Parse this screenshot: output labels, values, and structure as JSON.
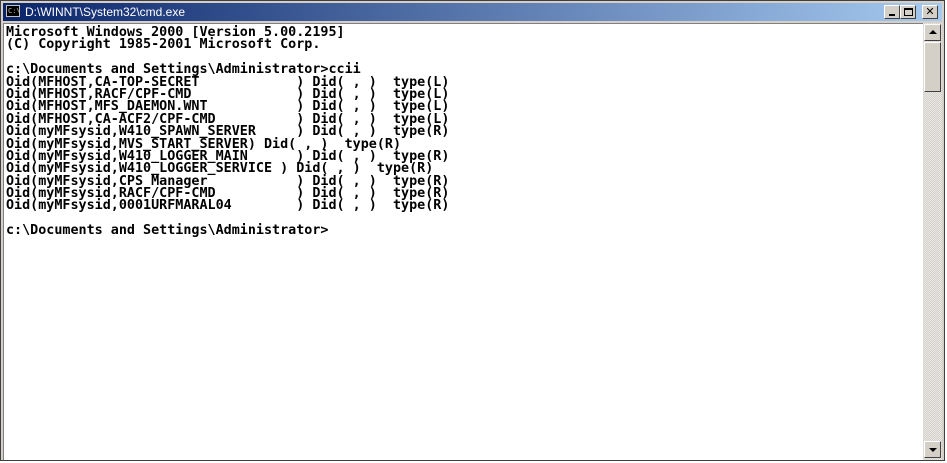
{
  "window": {
    "title": "D:\\WINNT\\System32\\cmd.exe",
    "icon": "cmd-icon",
    "controls": [
      "minimize-icon",
      "maximize-icon",
      "close-icon"
    ]
  },
  "console": {
    "lines": [
      "Microsoft Windows 2000 [Version 5.00.2195]",
      "(C) Copyright 1985-2001 Microsoft Corp.",
      "",
      "c:\\Documents and Settings\\Administrator>ccii",
      "Oid(MFHOST,CA-TOP-SECRET            ) Did( , )  type(L)",
      "Oid(MFHOST,RACF/CPF-CMD             ) Did( , )  type(L)",
      "Oid(MFHOST,MFS_DAEMON.WNT           ) Did( , )  type(L)",
      "Oid(MFHOST,CA-ACF2/CPF-CMD          ) Did( , )  type(L)",
      "Oid(myMFsysid,W410_SPAWN_SERVER     ) Did( , )  type(R)",
      "Oid(myMFsysid,MVS_START_SERVER) Did( , )  type(R)",
      "Oid(myMFsysid,W410_LOGGER_MAIN      ) Did( , )  type(R)",
      "Oid(myMFsysid,W410_LOGGER_SERVICE ) Did( , )  type(R)",
      "Oid(myMFsysid,CPS Manager           ) Did( , )  type(R)",
      "Oid(myMFsysid,RACF/CPF-CMD          ) Did( , )  type(R)",
      "Oid(myMFsysid,0001URFMARAL04        ) Did( , )  type(R)",
      "",
      "c:\\Documents and Settings\\Administrator>"
    ]
  },
  "scrollbar": {
    "up_icon": "scroll-up-arrow-icon",
    "down_icon": "scroll-down-arrow-icon"
  },
  "colors": {
    "titlebar_start": "#0a246a",
    "titlebar_end": "#a6caf0",
    "console_bg": "#ffffff",
    "console_fg": "#000000"
  }
}
